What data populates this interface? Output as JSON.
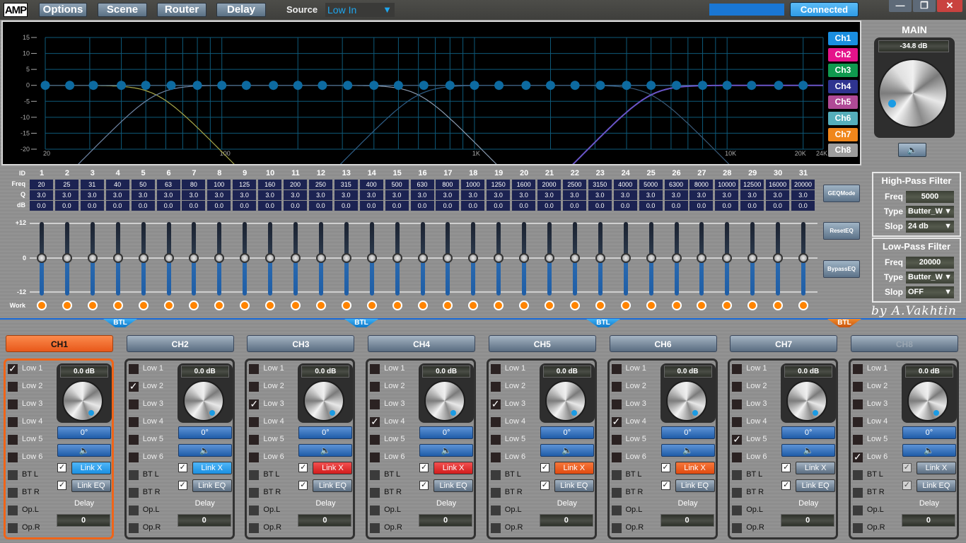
{
  "app": {
    "logo": "AMP"
  },
  "topbar": {
    "menu": [
      "Options",
      "Scene",
      "Router",
      "Delay"
    ],
    "source_label": "Source",
    "source_value": "Low In",
    "status": "Connected",
    "window_buttons": {
      "minimize": "—",
      "restore": "❐",
      "close": "✕"
    }
  },
  "graph": {
    "y_ticks": [
      "15",
      "10",
      "5",
      "0",
      "-5",
      "-10",
      "-15",
      "-20"
    ],
    "x_labels": [
      "20",
      "100",
      "1K",
      "10K",
      "20K",
      "24K"
    ],
    "channel_buttons": [
      {
        "label": "Ch1",
        "color": "#1a8ee0"
      },
      {
        "label": "Ch2",
        "color": "#e5138a"
      },
      {
        "label": "Ch3",
        "color": "#0f9a4f"
      },
      {
        "label": "Ch4",
        "color": "#2f3490"
      },
      {
        "label": "Ch5",
        "color": "#b04a96"
      },
      {
        "label": "Ch6",
        "color": "#55aebb"
      },
      {
        "label": "Ch7",
        "color": "#f0861b"
      },
      {
        "label": "Ch8",
        "color": "#9c9c9c"
      }
    ]
  },
  "main": {
    "title": "MAIN",
    "level": "-34.8  dB",
    "mute_icon": "speaker-icon"
  },
  "eq": {
    "row_labels": {
      "id": "ID",
      "freq": "Freq",
      "q": "Q",
      "db": "dB",
      "work": "Work"
    },
    "scale": {
      "top": "+12",
      "mid": "0",
      "bottom": "-12"
    },
    "bands": [
      {
        "id": "1",
        "freq": "20",
        "q": "3.0",
        "db": "0.0"
      },
      {
        "id": "2",
        "freq": "25",
        "q": "3.0",
        "db": "0.0"
      },
      {
        "id": "3",
        "freq": "31",
        "q": "3.0",
        "db": "0.0"
      },
      {
        "id": "4",
        "freq": "40",
        "q": "3.0",
        "db": "0.0"
      },
      {
        "id": "5",
        "freq": "50",
        "q": "3.0",
        "db": "0.0"
      },
      {
        "id": "6",
        "freq": "63",
        "q": "3.0",
        "db": "0.0"
      },
      {
        "id": "7",
        "freq": "80",
        "q": "3.0",
        "db": "0.0"
      },
      {
        "id": "8",
        "freq": "100",
        "q": "3.0",
        "db": "0.0"
      },
      {
        "id": "9",
        "freq": "125",
        "q": "3.0",
        "db": "0.0"
      },
      {
        "id": "10",
        "freq": "160",
        "q": "3.0",
        "db": "0.0"
      },
      {
        "id": "11",
        "freq": "200",
        "q": "3.0",
        "db": "0.0"
      },
      {
        "id": "12",
        "freq": "250",
        "q": "3.0",
        "db": "0.0"
      },
      {
        "id": "13",
        "freq": "315",
        "q": "3.0",
        "db": "0.0"
      },
      {
        "id": "14",
        "freq": "400",
        "q": "3.0",
        "db": "0.0"
      },
      {
        "id": "15",
        "freq": "500",
        "q": "3.0",
        "db": "0.0"
      },
      {
        "id": "16",
        "freq": "630",
        "q": "3.0",
        "db": "0.0"
      },
      {
        "id": "17",
        "freq": "800",
        "q": "3.0",
        "db": "0.0"
      },
      {
        "id": "18",
        "freq": "1000",
        "q": "3.0",
        "db": "0.0"
      },
      {
        "id": "19",
        "freq": "1250",
        "q": "3.0",
        "db": "0.0"
      },
      {
        "id": "20",
        "freq": "1600",
        "q": "3.0",
        "db": "0.0"
      },
      {
        "id": "21",
        "freq": "2000",
        "q": "3.0",
        "db": "0.0"
      },
      {
        "id": "22",
        "freq": "2500",
        "q": "3.0",
        "db": "0.0"
      },
      {
        "id": "23",
        "freq": "3150",
        "q": "3.0",
        "db": "0.0"
      },
      {
        "id": "24",
        "freq": "4000",
        "q": "3.0",
        "db": "0.0"
      },
      {
        "id": "25",
        "freq": "5000",
        "q": "3.0",
        "db": "0.0"
      },
      {
        "id": "26",
        "freq": "6300",
        "q": "3.0",
        "db": "0.0"
      },
      {
        "id": "27",
        "freq": "8000",
        "q": "3.0",
        "db": "0.0"
      },
      {
        "id": "28",
        "freq": "10000",
        "q": "3.0",
        "db": "0.0"
      },
      {
        "id": "29",
        "freq": "12500",
        "q": "3.0",
        "db": "0.0"
      },
      {
        "id": "30",
        "freq": "16000",
        "q": "3.0",
        "db": "0.0"
      },
      {
        "id": "31",
        "freq": "20000",
        "q": "3.0",
        "db": "0.0"
      }
    ],
    "buttons": [
      "GEQMode",
      "ResetEQ",
      "BypassEQ"
    ]
  },
  "high_pass": {
    "title": "High-Pass Filter",
    "freq_label": "Freq",
    "freq": "5000",
    "type_label": "Type",
    "type": "Butter_W",
    "slope_label": "Slop",
    "slope": "24 db"
  },
  "low_pass": {
    "title": "Low-Pass Filter",
    "freq_label": "Freq",
    "freq": "20000",
    "type_label": "Type",
    "type": "Butter_W",
    "slope_label": "Slop",
    "slope": "OFF"
  },
  "credit": "by A.Vakhtin",
  "btl_label": "BTL",
  "channel_row_labels": [
    "Low 1",
    "Low 2",
    "Low 3",
    "Low 4",
    "Low 5",
    "Low 6",
    "BT L",
    "BT R",
    "Op.L",
    "Op.R"
  ],
  "channels": [
    {
      "name": "CH1",
      "selected": true,
      "checked_row": 0,
      "level": "0.0 dB",
      "phase": "0°",
      "link_x": "Link X",
      "link_x_state": "blue",
      "link_eq": "Link EQ",
      "delay_label": "Delay",
      "delay": "0"
    },
    {
      "name": "CH2",
      "selected": false,
      "checked_row": 1,
      "level": "0.0 dB",
      "phase": "0°",
      "link_x": "Link X",
      "link_x_state": "blue",
      "link_eq": "Link EQ",
      "delay_label": "Delay",
      "delay": "0"
    },
    {
      "name": "CH3",
      "selected": false,
      "checked_row": 2,
      "level": "0.0 dB",
      "phase": "0°",
      "link_x": "Link X",
      "link_x_state": "red",
      "link_eq": "Link EQ",
      "delay_label": "Delay",
      "delay": "0"
    },
    {
      "name": "CH4",
      "selected": false,
      "checked_row": 3,
      "level": "0.0 dB",
      "phase": "0°",
      "link_x": "Link X",
      "link_x_state": "red",
      "link_eq": "Link EQ",
      "delay_label": "Delay",
      "delay": "0"
    },
    {
      "name": "CH5",
      "selected": false,
      "checked_row": 2,
      "level": "0.0 dB",
      "phase": "0°",
      "link_x": "Link X",
      "link_x_state": "orange",
      "link_eq": "Link EQ",
      "delay_label": "Delay",
      "delay": "0"
    },
    {
      "name": "CH6",
      "selected": false,
      "checked_row": 3,
      "level": "0.0 dB",
      "phase": "0°",
      "link_x": "Link X",
      "link_x_state": "orange",
      "link_eq": "Link EQ",
      "delay_label": "Delay",
      "delay": "0"
    },
    {
      "name": "CH7",
      "selected": false,
      "checked_row": 4,
      "level": "0.0 dB",
      "phase": "0°",
      "link_x": "Link X",
      "link_x_state": "grey",
      "link_eq": "Link EQ",
      "delay_label": "Delay",
      "delay": "0"
    },
    {
      "name": "CH8",
      "selected": false,
      "disabled": true,
      "checked_row": 5,
      "level": "0.0 dB",
      "phase": "0°",
      "link_x": "Link X",
      "link_x_state": "grey",
      "link_eq": "Link EQ",
      "delay_label": "Delay",
      "delay": "0"
    }
  ]
}
